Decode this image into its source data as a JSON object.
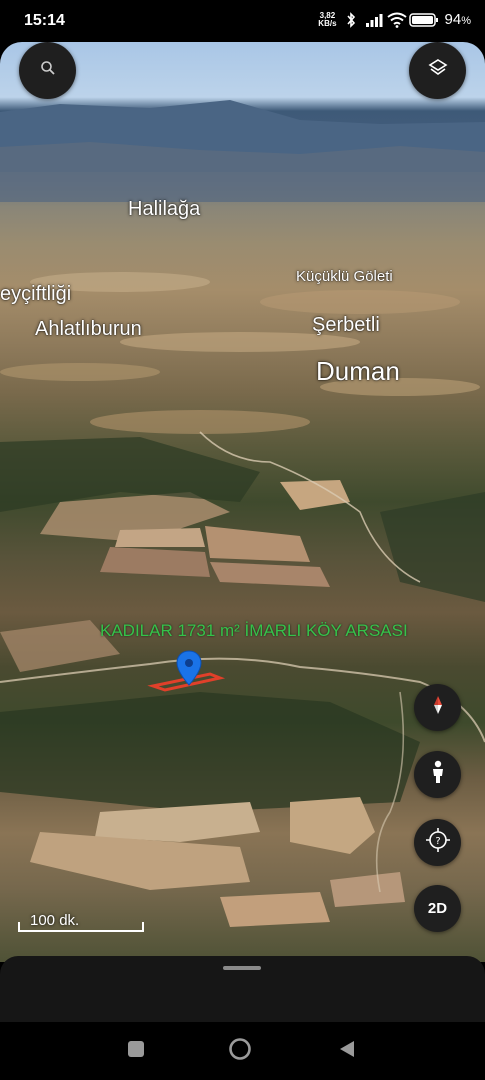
{
  "status_bar": {
    "time": "15:14",
    "net_speed_value": "3,82",
    "net_speed_unit": "KB/s",
    "battery": "94",
    "battery_unit": "%",
    "icons": [
      "bluetooth-icon",
      "signal-icon",
      "wifi-icon",
      "battery-icon"
    ]
  },
  "map": {
    "place_labels": {
      "halilaga": "Halilağa",
      "kucuklu_goleti": "Küçüklü Göleti",
      "eycifligi": "eyçiftliği",
      "ahlatliburun": "Ahlatlıburun",
      "serbetli": "Şerbetli",
      "duman": "Duman"
    },
    "pin_label": "KADILAR 1731 m² İMARLI KÖY ARSASI",
    "pin_color": "#1a73e8",
    "pin_label_color": "#35c24a",
    "parcel_outline_color": "#e0402a"
  },
  "controls": {
    "search_icon": "search-icon",
    "layers_icon": "layers-icon",
    "compass_icon": "compass-icon",
    "street_view_icon": "pegman-icon",
    "help_icon": "help-locate-icon",
    "mode_2d_label": "2D"
  },
  "scale": {
    "label": "100 dk."
  },
  "nav_bar": {
    "icons": [
      "recents-icon",
      "home-icon",
      "back-icon"
    ]
  }
}
